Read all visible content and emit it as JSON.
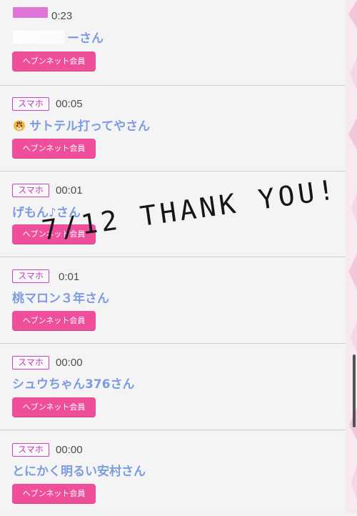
{
  "list": [
    {
      "device": "",
      "time": "0:23",
      "name": "ーさん",
      "member": "ヘブンネット会員"
    },
    {
      "device": "スマホ",
      "time": "00:05",
      "name": "サトテル打ってやさん",
      "member": "ヘブンネット会員",
      "emoji": "tiger-face-icon"
    },
    {
      "device": "スマホ",
      "time": "00:01",
      "name": "げもん♪さん",
      "member": "ヘブンネット会員"
    },
    {
      "device": "スマホ",
      "time": "0:01",
      "name": "桃マロン３年さん",
      "member": "ヘブンネット会員"
    },
    {
      "device": "スマホ",
      "time": "00:00",
      "name": "シュウちゃん376さん",
      "member": "ヘブンネット会員"
    },
    {
      "device": "スマホ",
      "time": "00:00",
      "name": "とにかく明るい安村さん",
      "member": "ヘブンネット会員"
    }
  ],
  "overlay": {
    "message": "7/12 THANK YOU!"
  },
  "colors": {
    "name": "#7b9ce0",
    "badge": "#c544c6",
    "button": "#ef4f9a"
  }
}
